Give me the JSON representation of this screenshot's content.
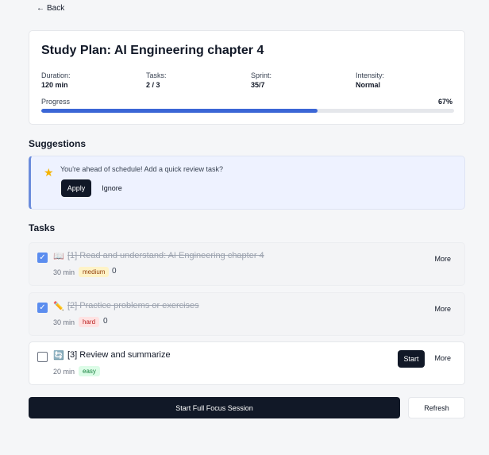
{
  "nav": {
    "back_icon": "←",
    "back_label": "Back"
  },
  "plan": {
    "title": "Study Plan: AI Engineering chapter 4",
    "stats": [
      {
        "label": "Duration:",
        "value": "120 min"
      },
      {
        "label": "Tasks:",
        "value": "2 / 3"
      },
      {
        "label": "Sprint:",
        "value": "35/7"
      },
      {
        "label": "Intensity:",
        "value": "Normal"
      }
    ],
    "progress_label": "Progress",
    "progress_text": "67%",
    "progress_fraction": 0.67
  },
  "suggestions": {
    "heading": "Suggestions",
    "icon": "star-icon",
    "text": "You're ahead of schedule! Add a quick review task?",
    "apply_label": "Apply",
    "ignore_label": "Ignore"
  },
  "tasks": {
    "heading": "Tasks",
    "items": [
      {
        "checked": true,
        "icon": "📖",
        "icon_name": "book-icon",
        "title": "[1] Read and understand: AI Engineering chapter 4",
        "time": "30 min",
        "difficulty": "medium",
        "count": "0",
        "more_label": "More"
      },
      {
        "checked": true,
        "icon": "✏️",
        "icon_name": "pencil-icon",
        "title": "[2] Practice problems or exercises",
        "time": "30 min",
        "difficulty": "hard",
        "count": "0",
        "more_label": "More"
      },
      {
        "checked": false,
        "icon": "🔄",
        "icon_name": "refresh-cycle-icon",
        "title": "[3] Review and summarize",
        "time": "20 min",
        "difficulty": "easy",
        "start_label": "Start",
        "more_label": "More"
      }
    ]
  },
  "footer": {
    "focus_label": "Start Full Focus Session",
    "refresh_label": "Refresh"
  },
  "colors": {
    "accent": "#3b66d6",
    "dark": "#111827",
    "checkbox": "#5b8def"
  }
}
